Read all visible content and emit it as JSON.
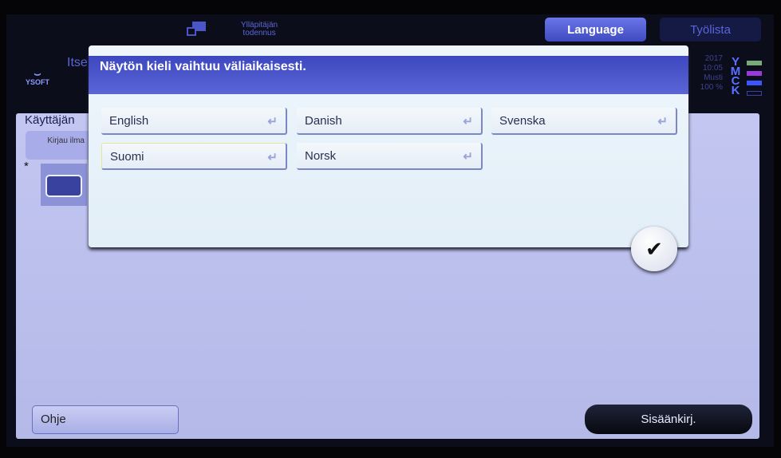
{
  "header": {
    "admin_auth": "Ylläpitäjän todennus",
    "language_tab": "Language",
    "joblist_tab": "Työlista"
  },
  "status": {
    "date": "2017",
    "time": "10:05",
    "memory_label": "Musti",
    "memory_value": "100 %"
  },
  "toner": [
    {
      "label": "Y",
      "color": "#7aa878"
    },
    {
      "label": "M",
      "color": "#9a38e0"
    },
    {
      "label": "C",
      "color": "#3a55ff"
    },
    {
      "label": "K",
      "color": "#141a44"
    }
  ],
  "logo": "YSOFT",
  "background": {
    "title_partial": "Itse",
    "section_title": "Käyttäjän",
    "login_method_partial": "Kirjau ilma",
    "required_marker": "*"
  },
  "dialog": {
    "message": "Näytön kieli vaihtuu väliaikaisesti.",
    "options": [
      {
        "label": "English",
        "selected": false
      },
      {
        "label": "Danish",
        "selected": false
      },
      {
        "label": "Svenska",
        "selected": false
      },
      {
        "label": "Suomi",
        "selected": true
      },
      {
        "label": "Norsk",
        "selected": false
      }
    ],
    "enter_icon": "↵",
    "ok_icon": "✔"
  },
  "footer": {
    "help": "Ohje",
    "login": "Sisäänkirj."
  }
}
